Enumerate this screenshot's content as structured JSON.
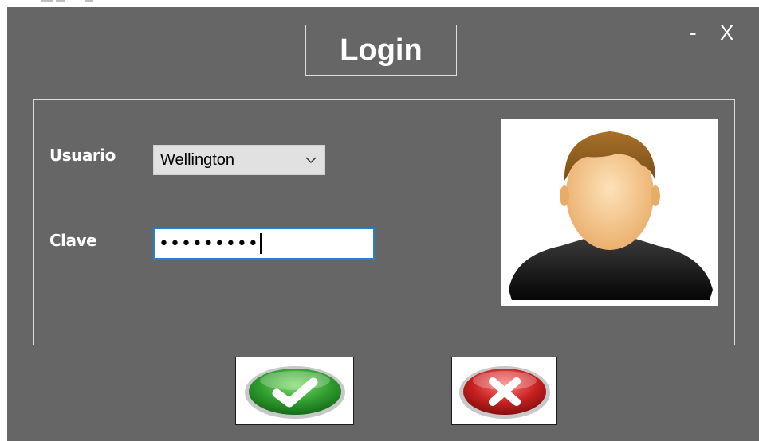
{
  "window": {
    "title": "Login",
    "minimize_label": "-",
    "close_label": "X"
  },
  "form": {
    "user_label": "Usuario",
    "user_value": "Wellington",
    "password_label": "Clave",
    "password_mask": "•••••••••"
  },
  "icons": {
    "dropdown": "chevron-down-icon",
    "avatar": "user-avatar-icon",
    "accept": "check-icon",
    "cancel": "x-icon"
  },
  "colors": {
    "window_bg": "#666666",
    "accept_green": "#2f9b2f",
    "cancel_red": "#c62020",
    "focus_blue": "#2a7fd4"
  }
}
